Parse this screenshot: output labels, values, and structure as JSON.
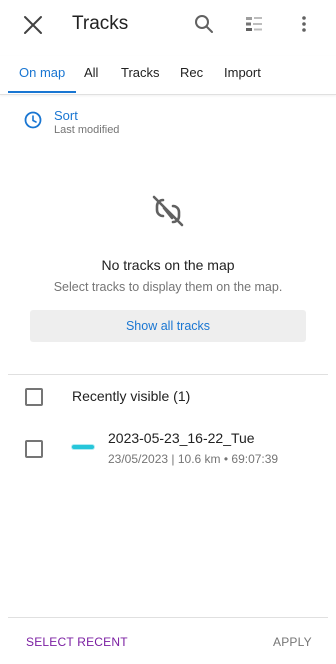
{
  "appbar": {
    "title": "Tracks",
    "close_icon": "close-icon",
    "search_icon": "search-icon",
    "filter_icon": "filter-list-icon",
    "more_icon": "more-vert-icon"
  },
  "tabs": [
    {
      "label": "On map",
      "active": true
    },
    {
      "label": "All",
      "active": false
    },
    {
      "label": "Tracks",
      "active": false
    },
    {
      "label": "Rec",
      "active": false
    },
    {
      "label": "Import",
      "active": false
    }
  ],
  "sort": {
    "label": "Sort",
    "value": "Last modified",
    "icon": "clock-icon"
  },
  "empty_state": {
    "icon": "link-off-icon",
    "title": "No tracks on the map",
    "subtitle": "Select tracks to display them on the map.",
    "button_label": "Show all tracks"
  },
  "group": {
    "label": "Recently visible (1)",
    "checked": false
  },
  "tracks": [
    {
      "name": "2023-05-23_16-22_Tue",
      "meta": "23/05/2023 | 10.6 km • 69:07:39",
      "checked": false,
      "color": "#26c6da"
    }
  ],
  "bottom": {
    "select_recent_label": "SELECT RECENT",
    "apply_label": "APPLY"
  },
  "colors": {
    "accent": "#1976d2",
    "secondary_accent": "#7b1fa2",
    "muted_text": "#757575"
  }
}
